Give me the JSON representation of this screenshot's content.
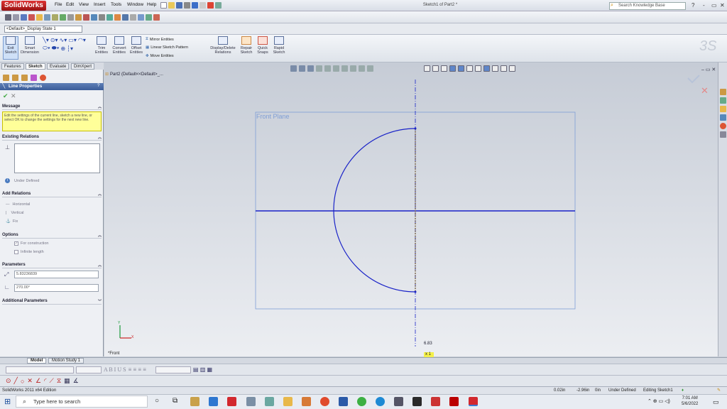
{
  "app": {
    "name": "SolidWorks",
    "document_title": "Sketch1 of Part2 *"
  },
  "menu": [
    "File",
    "Edit",
    "View",
    "Insert",
    "Tools",
    "Window",
    "Help"
  ],
  "search": {
    "placeholder": "Search Knowledge Base"
  },
  "window_buttons": [
    "?",
    "-",
    "▭",
    "✕"
  ],
  "config_selector": {
    "value": "<Default>_Display State 1"
  },
  "command_manager": {
    "exit_sketch": "Exit Sketch",
    "smart_dimension": "Smart Dimension",
    "trim_entities": "Trim Entities",
    "convert_entities": "Convert Entities",
    "offset_entities": "Offset Entities",
    "mirror_entities": "Mirror Entities",
    "linear_sketch_pattern": "Linear Sketch Pattern",
    "move_entities": "Move Entities",
    "display_delete_relations": "Display/Delete Relations",
    "repair_sketch": "Repair Sketch",
    "quick_snaps": "Quick Snaps",
    "rapid_sketch": "Rapid Sketch"
  },
  "tabs": [
    "Features",
    "Sketch",
    "Evaluate",
    "DimXpert"
  ],
  "active_tab": "Sketch",
  "property_manager": {
    "title": "Line Properties",
    "message_header": "Message",
    "message": "Edit the settings of the current line, sketch a new line, or select OK to change the settings for the next new line.",
    "existing_relations_header": "Existing Relations",
    "status": "Under Defined",
    "add_relations_header": "Add Relations",
    "add_relations": [
      "Horizontal",
      "Vertical",
      "Fix"
    ],
    "options_header": "Options",
    "options": [
      {
        "label": "For construction",
        "checked": true
      },
      {
        "label": "Infinite length",
        "checked": false
      }
    ],
    "parameters_header": "Parameters",
    "length": "5.83236839",
    "angle": "270.00°",
    "additional_header": "Additional Parameters"
  },
  "graphics": {
    "tree_item": "Part2 (Default<<Default>_...",
    "plane_label": "Front Plane",
    "view_label": "*Front",
    "dimension_value": "6.83",
    "dimension_tag": "x 1"
  },
  "bottom_tabs": [
    "Model",
    "Motion Study 1"
  ],
  "active_bottom_tab": "Model",
  "status_bar": {
    "left": "SolidWorks 2011 x64 Edition",
    "x": "0.02in",
    "y": "-2.96in",
    "z": "0in",
    "state": "Under Defined",
    "editing": "Editing Sketch1"
  },
  "taskbar": {
    "search_placeholder": "Type here to search",
    "time": "7:01 AM",
    "date": "5/6/2022"
  },
  "colors": {
    "accent": "#3a5c98",
    "sketch_blue": "#1a23c8",
    "message_bg": "#ffff99"
  }
}
